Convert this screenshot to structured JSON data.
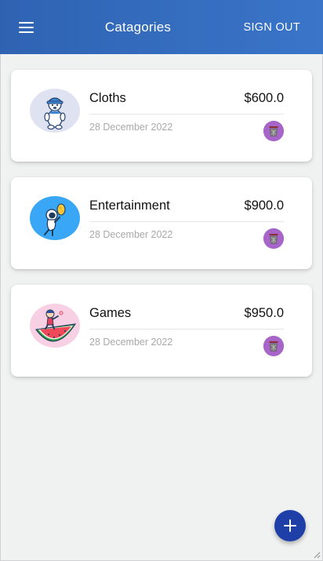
{
  "header": {
    "title": "Catagories",
    "sign_out_label": "SIGN OUT",
    "menu_icon": "hamburger-menu-icon",
    "background": "#3a6fc0"
  },
  "categories": [
    {
      "name": "Cloths",
      "amount": "$600.0",
      "date": "28 December 2022",
      "avatar_icon": "polar-bear-icon",
      "avatar_bg": "#dfe3f1",
      "delete_icon": "trash-icon"
    },
    {
      "name": "Entertainment",
      "amount": "$900.0",
      "date": "28 December 2022",
      "avatar_icon": "astronaut-icon",
      "avatar_bg": "#39a7f5",
      "delete_icon": "trash-icon"
    },
    {
      "name": "Games",
      "amount": "$950.0",
      "date": "28 December 2022",
      "avatar_icon": "watermelon-surfer-icon",
      "avatar_bg": "#f8d0e4",
      "delete_icon": "trash-icon"
    }
  ],
  "fab": {
    "icon": "plus-icon",
    "color": "#1f3fa8"
  },
  "colors": {
    "delete_button": "#a865c9",
    "page_background": "#f0f1f1"
  }
}
